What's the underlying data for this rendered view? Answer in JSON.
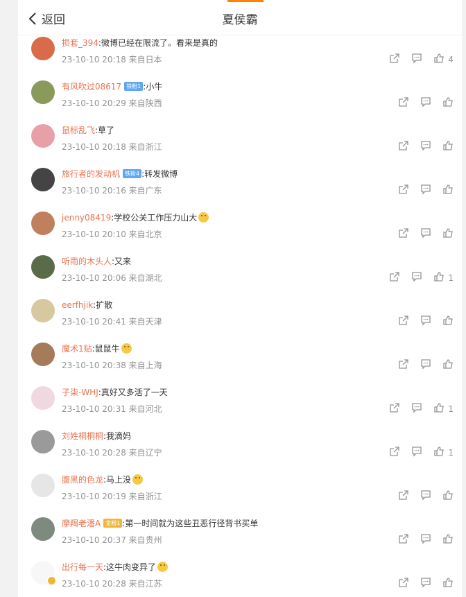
{
  "header": {
    "back_label": "返回",
    "title": "夏侯霸"
  },
  "comments": [
    {
      "user": "损套_394",
      "badge": "",
      "badge_type": "",
      "text": ":微博已经在限流了。看来是真的",
      "emoji": false,
      "meta": "23-10-10 20:18 来自日本",
      "likes": "4",
      "avatar_color": "#d96a4a"
    },
    {
      "user": "有风吹过08617",
      "badge": "铁粉1",
      "badge_type": "blue",
      "text": ":小牛",
      "emoji": false,
      "meta": "23-10-10 20:29 来自陕西",
      "likes": "",
      "avatar_color": "#8a9a5b"
    },
    {
      "user": "鼠标乱飞",
      "badge": "",
      "badge_type": "",
      "text": ":草了",
      "emoji": false,
      "meta": "23-10-10 20:18 来自浙江",
      "likes": "",
      "avatar_color": "#e8a0a8"
    },
    {
      "user": "旅行者的发动机",
      "badge": "铁粉4",
      "badge_type": "blue",
      "text": ":转发微博",
      "emoji": false,
      "meta": "23-10-10 20:16 来自广东",
      "likes": "",
      "avatar_color": "#444444"
    },
    {
      "user": "jenny08419",
      "badge": "",
      "badge_type": "",
      "text": ":学校公关工作压力山大",
      "emoji": true,
      "meta": "23-10-10 20:10 来自北京",
      "likes": "",
      "avatar_color": "#c08060"
    },
    {
      "user": "听雨的木头人",
      "badge": "",
      "badge_type": "",
      "text": ":又来",
      "emoji": false,
      "meta": "23-10-10 20:06 来自湖北",
      "likes": "1",
      "avatar_color": "#5a6b4a"
    },
    {
      "user": "eerfhjik",
      "badge": "",
      "badge_type": "",
      "text": ":扩散",
      "emoji": false,
      "meta": "23-10-10 20:41 来自天津",
      "likes": "",
      "avatar_color": "#d8c8a0"
    },
    {
      "user": "魔术1贴",
      "badge": "",
      "badge_type": "",
      "text": ":鼠鼠牛",
      "emoji": true,
      "meta": "23-10-10 20:38 来自上海",
      "likes": "",
      "avatar_color": "#a67b5b"
    },
    {
      "user": "子柒-WHJ",
      "badge": "",
      "badge_type": "",
      "text": ":真好又多活了一天",
      "emoji": false,
      "meta": "23-10-10 20:31 来自河北",
      "likes": "1",
      "avatar_color": "#f0d8e0"
    },
    {
      "user": "刘姓桐桐桐",
      "badge": "",
      "badge_type": "",
      "text": ":我滴妈",
      "emoji": false,
      "meta": "23-10-10 20:28 来自辽宁",
      "likes": "1",
      "avatar_color": "#9a9a9a"
    },
    {
      "user": "腹黑的色龙",
      "badge": "",
      "badge_type": "",
      "text": ":马上没",
      "emoji": true,
      "meta": "23-10-10 20:19 来自浙江",
      "likes": "",
      "avatar_color": "#e6e6e6"
    },
    {
      "user": "摩羯老潘A",
      "badge": "金粉1",
      "badge_type": "gold",
      "text": ":第一时间就为这些丑恶行径背书买单",
      "emoji": false,
      "meta": "23-10-10 20:37 来自贵州",
      "likes": "",
      "avatar_color": "#7d8a7d"
    },
    {
      "user": "出行每一天",
      "badge": "",
      "badge_type": "",
      "text": ":这牛肉变异了",
      "emoji": true,
      "meta": "23-10-10 20:28 来自江苏",
      "likes": "",
      "avatar_color": "#f7f7f7"
    }
  ]
}
